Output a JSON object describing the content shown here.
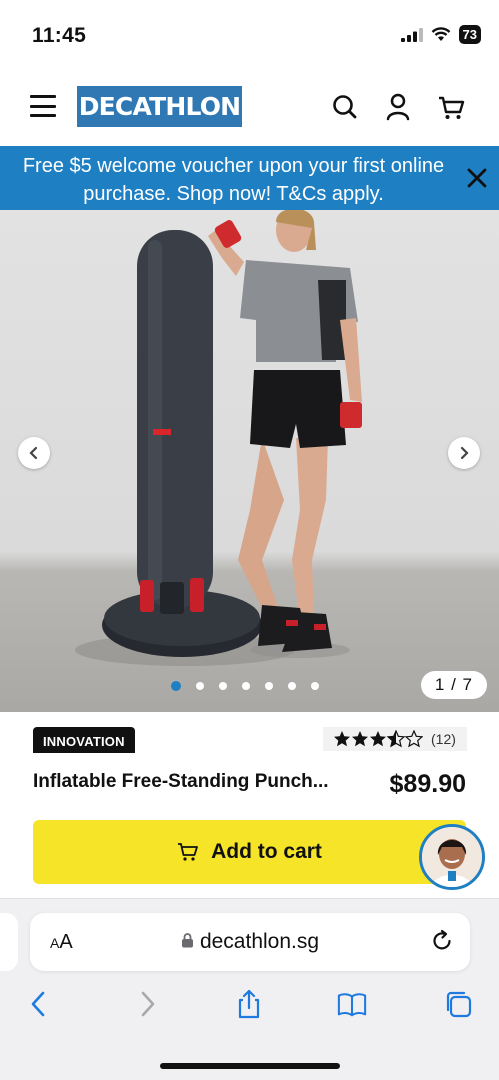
{
  "status_bar": {
    "time": "11:45",
    "battery": "73",
    "icons": [
      "signal-icon",
      "wifi-icon",
      "battery-icon"
    ]
  },
  "header": {
    "logo": "DECATHLON",
    "icons": [
      "menu-icon",
      "search-icon",
      "account-icon",
      "cart-icon"
    ]
  },
  "promo": {
    "text": "Free $5 welcome voucher upon your first online purchase. Shop now! T&Cs apply."
  },
  "gallery": {
    "counter": "1 / 7",
    "total_images": 7,
    "active_index": 1
  },
  "product": {
    "badge": "INNOVATION",
    "rating": 3.5,
    "review_count": "(12)",
    "title": "Inflatable Free-Standing Punch...",
    "price": "$89.90",
    "add_to_cart_label": "Add to cart"
  },
  "browser": {
    "aa_label_small": "A",
    "aa_label": "A",
    "url": "decathlon.sg",
    "toolbar": [
      "back-icon",
      "forward-icon",
      "share-icon",
      "bookmarks-icon",
      "tabs-icon"
    ]
  },
  "colors": {
    "brand_blue": "#3078b4",
    "promo_blue": "#1e7fc3",
    "cta_yellow": "#f5e427"
  }
}
